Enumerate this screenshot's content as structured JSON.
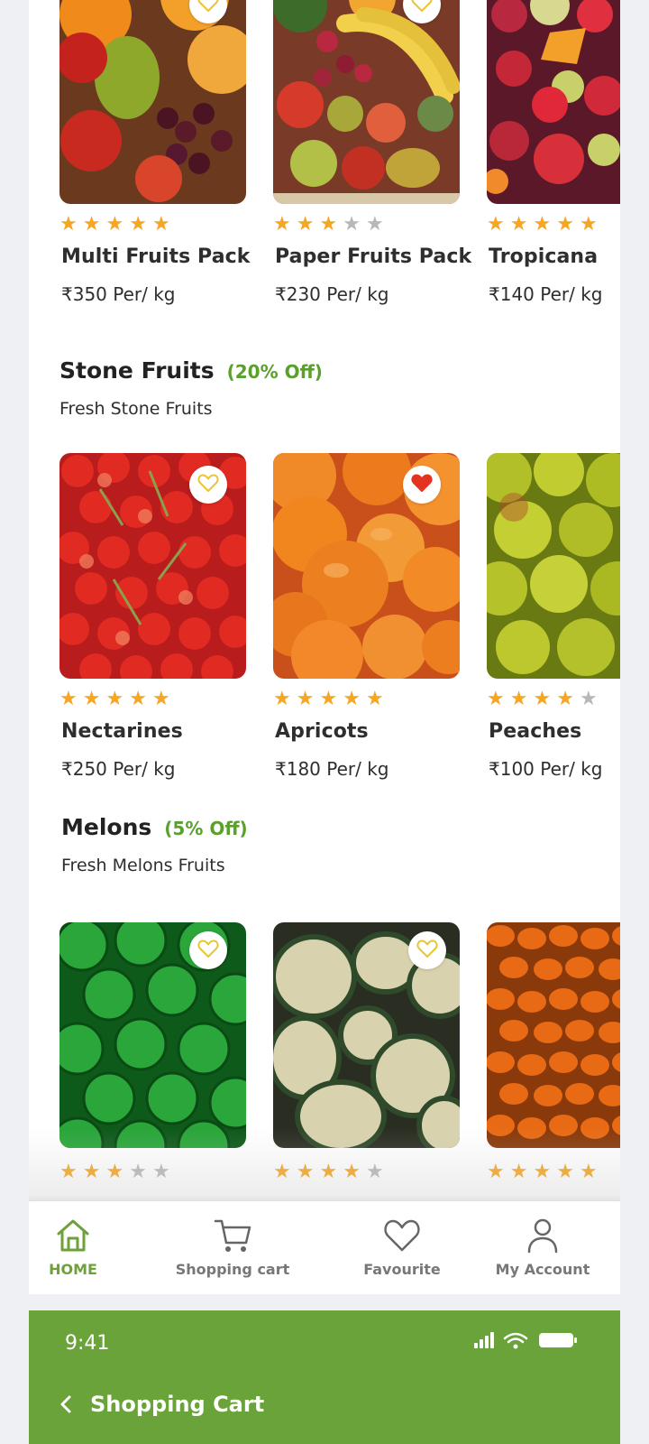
{
  "rows": {
    "top": {
      "products": [
        {
          "name": "Multi Fruits Pack",
          "price": "₹350 Per/ kg",
          "rating": 5,
          "favourite": false
        },
        {
          "name": "Paper Fruits Pack",
          "price": "₹230 Per/ kg",
          "rating": 3,
          "favourite": false
        },
        {
          "name": "Tropicana",
          "price": "₹140 Per/ kg",
          "rating": 5,
          "favourite": false
        }
      ]
    },
    "stone": {
      "title": "Stone Fruits",
      "discount": "(20% Off)",
      "subtitle": "Fresh Stone Fruits",
      "products": [
        {
          "name": "Nectarines",
          "price": "₹250 Per/ kg",
          "rating": 5,
          "favourite": false
        },
        {
          "name": "Apricots",
          "price": "₹180 Per/ kg",
          "rating": 5,
          "favourite": true
        },
        {
          "name": "Peaches",
          "price": "₹100 Per/ kg",
          "rating": 4,
          "favourite": false
        }
      ]
    },
    "melons": {
      "title": "Melons",
      "discount": "(5% Off)",
      "subtitle": "Fresh Melons Fruits",
      "products": [
        {
          "rating": 3,
          "favourite": false
        },
        {
          "rating": 4,
          "favourite": false
        },
        {
          "rating": 5,
          "favourite": false
        }
      ]
    }
  },
  "bottom_nav": {
    "home": "HOME",
    "cart": "Shopping cart",
    "favourite": "Favourite",
    "account": "My Account"
  },
  "status_bar": {
    "time": "9:41"
  },
  "header": {
    "title": "Shopping Cart"
  },
  "colors": {
    "accent_green": "#6ba33b",
    "star_filled": "#f5a623",
    "star_empty": "#b8b8b8",
    "heart_active": "#e53322",
    "heart_outline": "#e8c532"
  }
}
